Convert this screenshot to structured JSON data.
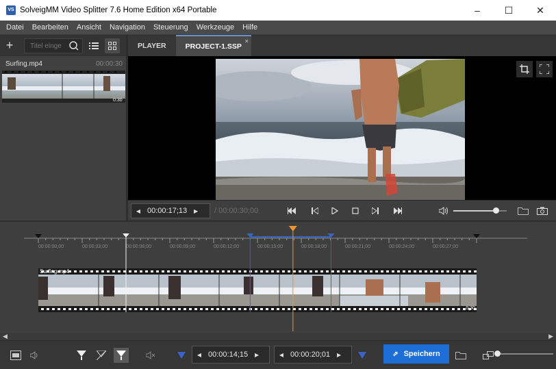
{
  "window": {
    "title": "SolveigMM Video Splitter 7.6 Home Edition x64 Portable",
    "app_icon_text": "VS"
  },
  "menu": [
    "Datei",
    "Bearbeiten",
    "Ansicht",
    "Navigation",
    "Steuerung",
    "Werkzeuge",
    "Hilfe"
  ],
  "library": {
    "search_placeholder": "Titel einge",
    "file_name": "Surfing.mp4",
    "file_duration": "00:00:30",
    "thumb_duration": "0:30"
  },
  "tabs": [
    {
      "label": "PLAYER",
      "active": false
    },
    {
      "label": "PROJECT-1.SSP",
      "active": true
    }
  ],
  "player": {
    "current_time": "00:00:17;13",
    "total_time": "/ 00:00:30;00",
    "volume": 0.8
  },
  "timeline": {
    "ticks": [
      "00:00:00;00",
      "00:00:03;00",
      "00:00:06;00",
      "00:00:09;00",
      "00:00:12;00",
      "00:00:15;00",
      "00:00:18;00",
      "00:00:21;00",
      "00:00:24;00",
      "00:00:27;00"
    ],
    "clip_name": "Surfing.mp4",
    "clip_duration": "0:30",
    "selection_start_seconds": 14.5,
    "selection_end_seconds": 20.04,
    "playhead_seconds": 17.43,
    "white_marker_seconds": 6.0
  },
  "bottom": {
    "mark_in": "00:00:14;15",
    "mark_out": "00:00:20;01",
    "save_label": "Speichern"
  },
  "colors": {
    "accent": "#1e6ed8",
    "selection": "#3a64c8",
    "playhead": "#f0962a"
  }
}
